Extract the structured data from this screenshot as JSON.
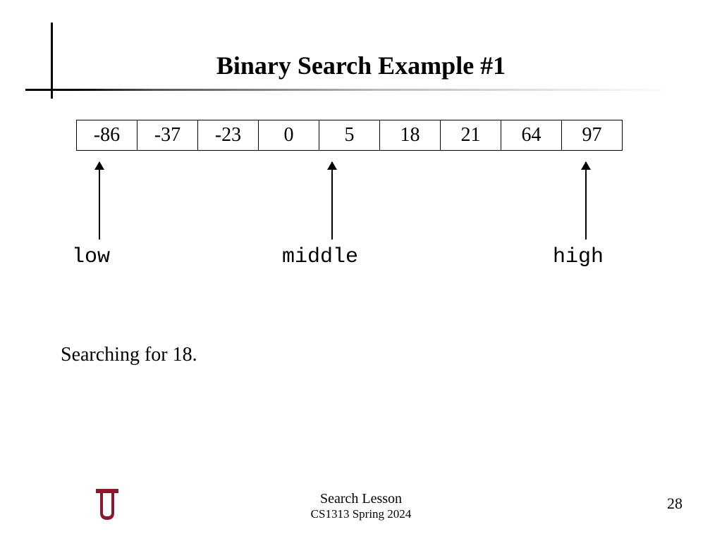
{
  "title": "Binary Search Example #1",
  "array": [
    "-86",
    "-37",
    "-23",
    "0",
    "5",
    "18",
    "21",
    "64",
    "97"
  ],
  "pointers": {
    "low": "low",
    "middle": "middle",
    "high": "high"
  },
  "caption": "Searching for 18.",
  "footer": {
    "lesson": "Search Lesson",
    "course": "CS1313 Spring 2024",
    "page": "28"
  },
  "logo": {
    "name": "ou-logo",
    "color": "#8a1a2b"
  }
}
